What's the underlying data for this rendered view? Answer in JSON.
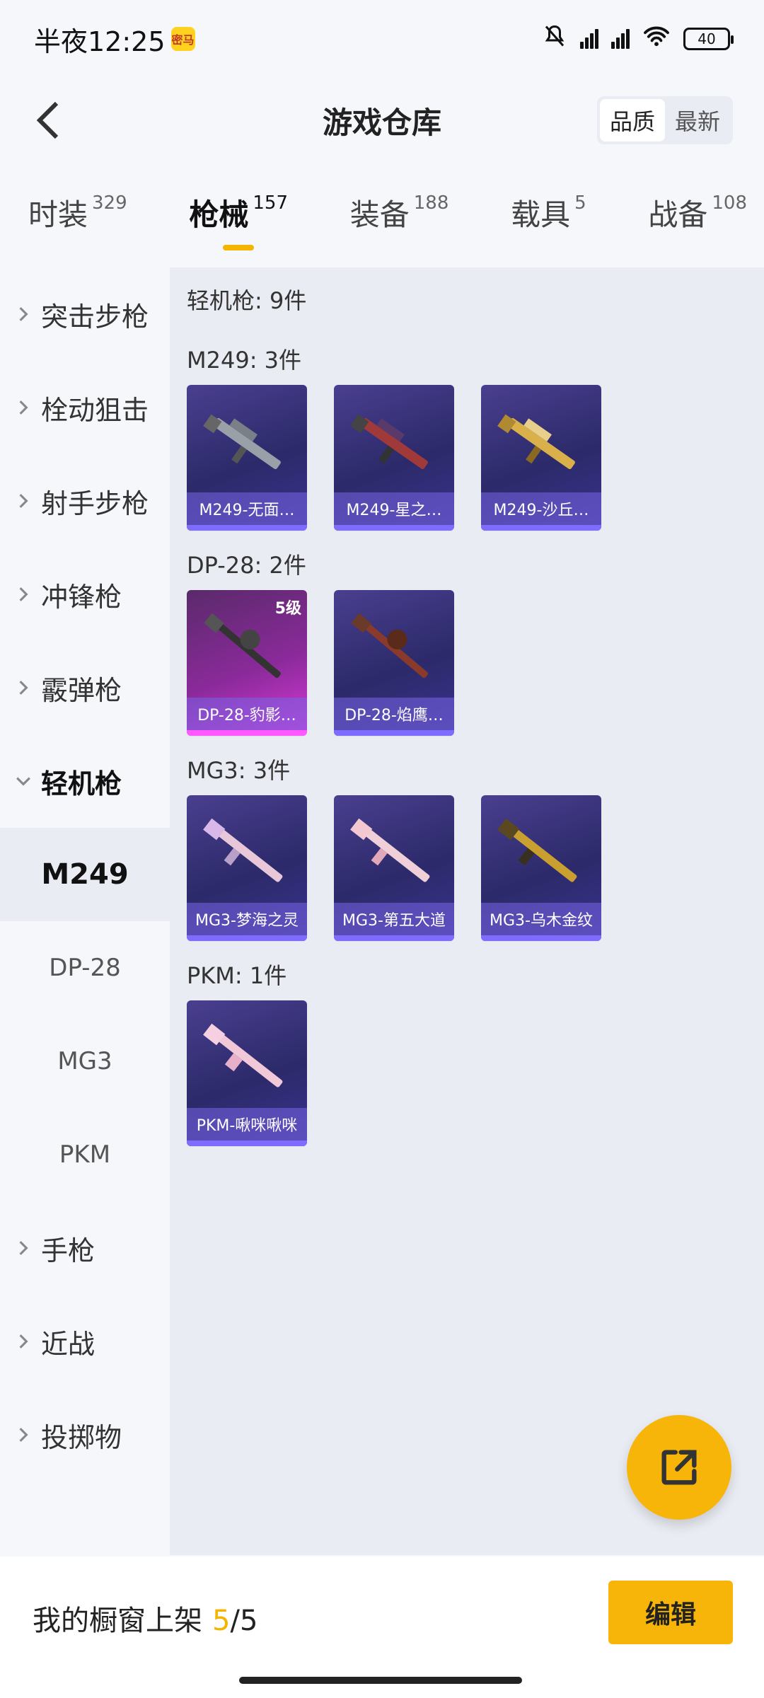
{
  "status": {
    "time": "半夜12:25",
    "app_icon": "密马",
    "battery": "40",
    "icons": [
      "mute-icon",
      "hd-signal-icon",
      "hd-signal-icon",
      "wifi-icon",
      "battery-icon"
    ]
  },
  "header": {
    "title": "游戏仓库",
    "sort_options": [
      "品质",
      "最新"
    ],
    "sort_active": "品质"
  },
  "tabs": [
    {
      "label": "时装",
      "count": "329"
    },
    {
      "label": "枪械",
      "count": "157",
      "active": true
    },
    {
      "label": "装备",
      "count": "188"
    },
    {
      "label": "载具",
      "count": "5"
    },
    {
      "label": "战备",
      "count": "108"
    }
  ],
  "sidebar": {
    "items": [
      {
        "label": "突击步枪"
      },
      {
        "label": "栓动狙击"
      },
      {
        "label": "射手步枪"
      },
      {
        "label": "冲锋枪"
      },
      {
        "label": "霰弹枪"
      },
      {
        "label": "轻机枪",
        "open": true
      },
      {
        "label": "手枪"
      },
      {
        "label": "近战"
      },
      {
        "label": "投掷物"
      }
    ],
    "subitems": [
      "M249",
      "DP-28",
      "MG3",
      "PKM"
    ],
    "active_sub": "M249"
  },
  "main": {
    "total": "轻机枪: 9件",
    "groups": [
      {
        "title": "M249: 3件",
        "cards": [
          {
            "name": "M249-无面…",
            "color": "#9aa0a8"
          },
          {
            "name": "M249-星之…",
            "color": "#a03a3a"
          },
          {
            "name": "M249-沙丘…",
            "color": "#d9b04a"
          }
        ]
      },
      {
        "title": "DP-28: 2件",
        "cards": [
          {
            "name": "DP-28-豹影…",
            "color": "#333",
            "badge": "5级",
            "pink": true
          },
          {
            "name": "DP-28-焰鹰…",
            "color": "#8a3a2a"
          }
        ]
      },
      {
        "title": "MG3: 3件",
        "cards": [
          {
            "name": "MG3-梦海之灵",
            "color": "#e8c8d8"
          },
          {
            "name": "MG3-第五大道",
            "color": "#f0d0d8"
          },
          {
            "name": "MG3-乌木金纹",
            "color": "#c9a030"
          }
        ]
      },
      {
        "title": "PKM: 1件",
        "cards": [
          {
            "name": "PKM-啾咪啾咪",
            "color": "#f0c8d8"
          }
        ]
      }
    ]
  },
  "bottom": {
    "showcase_label": "我的橱窗上架",
    "used": "5",
    "sep": "/",
    "limit": "5",
    "edit_label": "编辑"
  },
  "colors": {
    "accent": "#f7b50a",
    "card_bg": "#3a3390",
    "card_pink": "#d93ad9"
  }
}
